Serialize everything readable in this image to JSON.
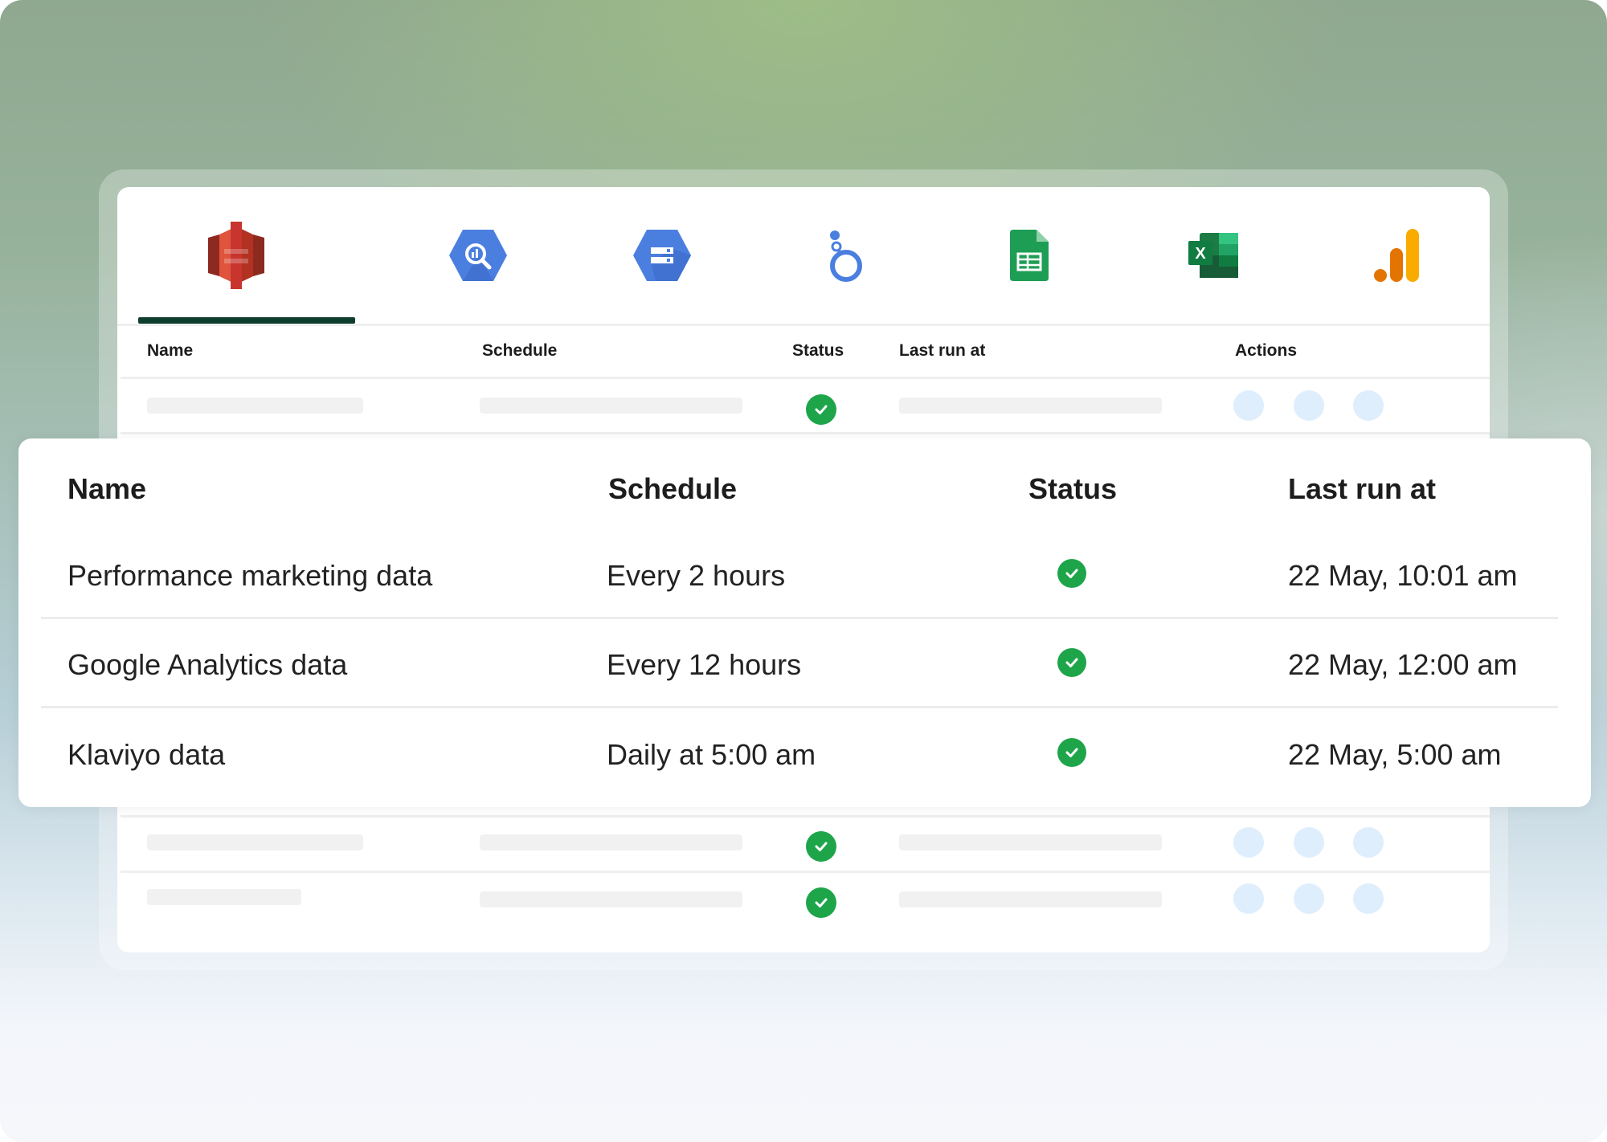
{
  "connectors": [
    {
      "name": "amazon-s3-icon",
      "color": "#c7352e"
    },
    {
      "name": "bigquery-icon",
      "color": "#4a7fe0"
    },
    {
      "name": "cloud-storage-icon",
      "color": "#4a7fe0"
    },
    {
      "name": "looker-icon",
      "color": "#4a7fe0"
    },
    {
      "name": "google-sheets-icon",
      "color": "#1e9d55"
    },
    {
      "name": "excel-icon",
      "color": "#1d7b44"
    },
    {
      "name": "google-analytics-icon",
      "color": "#f3a21a"
    }
  ],
  "back_table": {
    "headers": {
      "name": "Name",
      "schedule": "Schedule",
      "status": "Status",
      "last_run": "Last run at",
      "actions": "Actions"
    }
  },
  "front_table": {
    "headers": {
      "name": "Name",
      "schedule": "Schedule",
      "status": "Status",
      "last_run": "Last run at"
    },
    "rows": [
      {
        "name": "Performance marketing data",
        "schedule": "Every 2 hours",
        "last_run": "22 May, 10:01 am"
      },
      {
        "name": "Google Analytics data",
        "schedule": "Every 12 hours",
        "last_run": "22 May, 12:00 am"
      },
      {
        "name": "Klaviyo data",
        "schedule": "Daily at 5:00 am",
        "last_run": "22 May, 5:00 am"
      }
    ]
  },
  "colors": {
    "accent": "#0f3d2e",
    "success": "#1ea54a",
    "action_dot": "#dfeefc",
    "skeleton": "#f1f1f1"
  }
}
